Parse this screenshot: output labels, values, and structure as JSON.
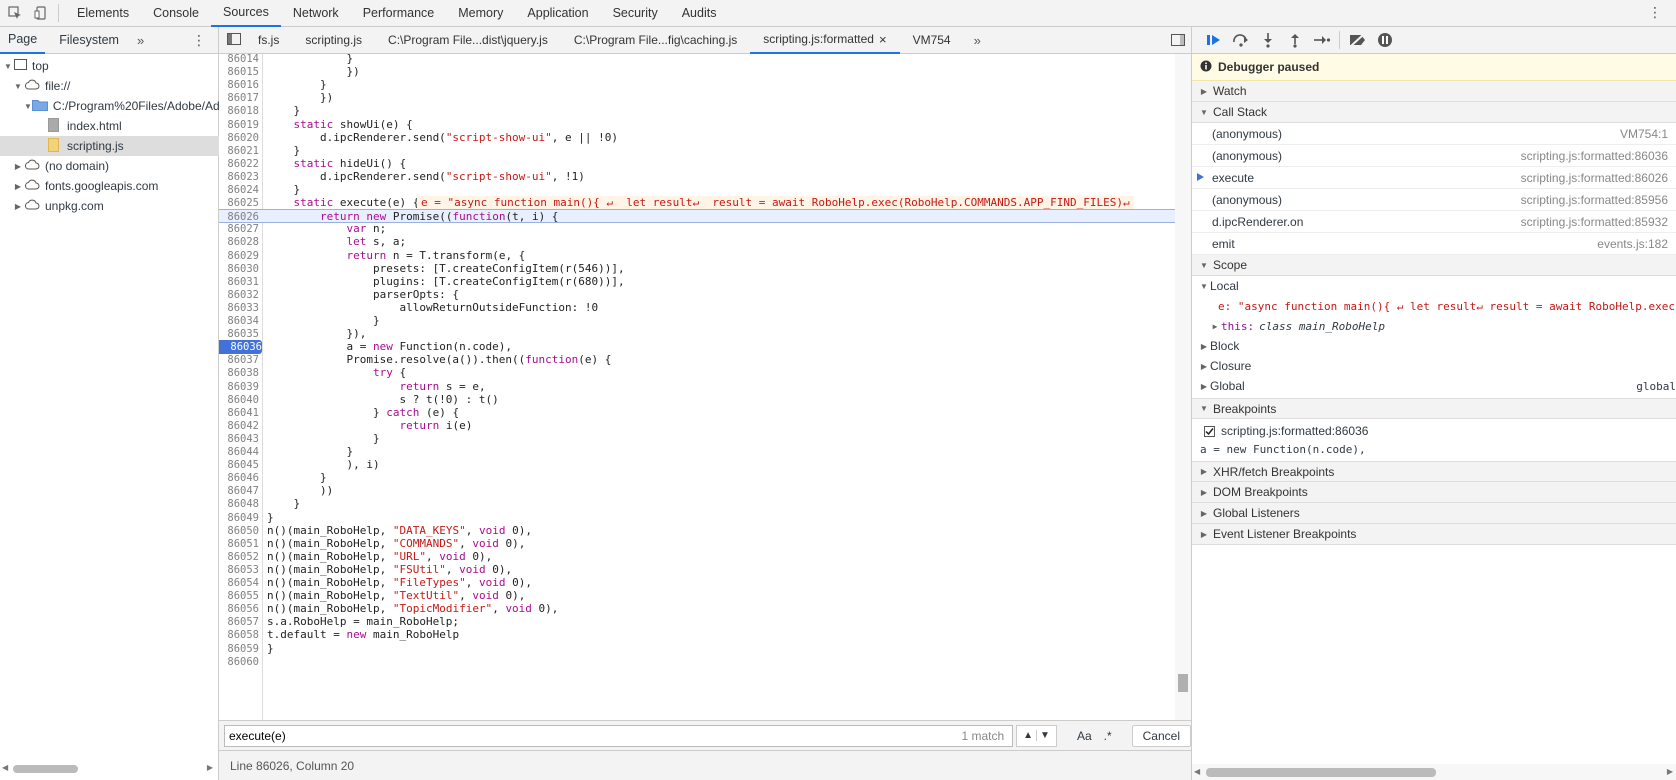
{
  "toolbar": {
    "tabs": [
      "Elements",
      "Console",
      "Sources",
      "Network",
      "Performance",
      "Memory",
      "Application",
      "Security",
      "Audits"
    ],
    "active_tab": "Sources"
  },
  "navigator": {
    "tabs": [
      "Page",
      "Filesystem"
    ],
    "tree": [
      "top",
      "file://",
      "C:/Program%20Files/Adobe/Ad",
      "index.html",
      "scripting.js",
      "(no domain)",
      "fonts.googleapis.com",
      "unpkg.com"
    ]
  },
  "editor": {
    "file_tabs": [
      "fs.js",
      "scripting.js",
      "C:\\Program File...dist\\jquery.js",
      "C:\\Program File...fig\\caching.js",
      "scripting.js:formatted",
      "VM754"
    ],
    "close_icon": "×",
    "lines": [
      {
        "n": "86014",
        "code": "            }"
      },
      {
        "n": "86015",
        "code": "            })"
      },
      {
        "n": "86016",
        "code": "        }"
      },
      {
        "n": "86017",
        "code": "        })"
      },
      {
        "n": "86018",
        "code": "    }"
      },
      {
        "n": "86019",
        "code": "    static showUi(e) {"
      },
      {
        "n": "86020",
        "code": "        d.ipcRenderer.send(\"script-show-ui\", e || !0)"
      },
      {
        "n": "86021",
        "code": "    }"
      },
      {
        "n": "86022",
        "code": "    static hideUi() {"
      },
      {
        "n": "86023",
        "code": "        d.ipcRenderer.send(\"script-show-ui\", !1)"
      },
      {
        "n": "86024",
        "code": "    }"
      },
      {
        "n": "86025",
        "code": "    static execute(e) {"
      },
      {
        "n": "86026",
        "code": "        return new Promise((function(t, i) {"
      },
      {
        "n": "86027",
        "code": "            var n;"
      },
      {
        "n": "86028",
        "code": "            let s, a;"
      },
      {
        "n": "86029",
        "code": "            return n = T.transform(e, {"
      },
      {
        "n": "86030",
        "code": "                presets: [T.createConfigItem(r(546))],"
      },
      {
        "n": "86031",
        "code": "                plugins: [T.createConfigItem(r(680))],"
      },
      {
        "n": "86032",
        "code": "                parserOpts: {"
      },
      {
        "n": "86033",
        "code": "                    allowReturnOutsideFunction: !0"
      },
      {
        "n": "86034",
        "code": "                }"
      },
      {
        "n": "86035",
        "code": "            }),"
      },
      {
        "n": "86036",
        "code": "            a = new Function(n.code),"
      },
      {
        "n": "86037",
        "code": "            Promise.resolve(a()).then((function(e) {"
      },
      {
        "n": "86038",
        "code": "                try {"
      },
      {
        "n": "86039",
        "code": "                    return s = e,"
      },
      {
        "n": "86040",
        "code": "                    s ? t(!0) : t()"
      },
      {
        "n": "86041",
        "code": "                } catch (e) {"
      },
      {
        "n": "86042",
        "code": "                    return i(e)"
      },
      {
        "n": "86043",
        "code": "                }"
      },
      {
        "n": "86044",
        "code": "            }"
      },
      {
        "n": "86045",
        "code": "            ), i)"
      },
      {
        "n": "86046",
        "code": "        }"
      },
      {
        "n": "86047",
        "code": "        ))"
      },
      {
        "n": "86048",
        "code": "    }"
      },
      {
        "n": "86049",
        "code": "}"
      },
      {
        "n": "86050",
        "code": "n()(main_RoboHelp, \"DATA_KEYS\", void 0),"
      },
      {
        "n": "86051",
        "code": "n()(main_RoboHelp, \"COMMANDS\", void 0),"
      },
      {
        "n": "86052",
        "code": "n()(main_RoboHelp, \"URL\", void 0),"
      },
      {
        "n": "86053",
        "code": "n()(main_RoboHelp, \"FSUtil\", void 0),"
      },
      {
        "n": "86054",
        "code": "n()(main_RoboHelp, \"FileTypes\", void 0),"
      },
      {
        "n": "86055",
        "code": "n()(main_RoboHelp, \"TextUtil\", void 0),"
      },
      {
        "n": "86056",
        "code": "n()(main_RoboHelp, \"TopicModifier\", void 0),"
      },
      {
        "n": "86057",
        "code": "s.a.RoboHelp = main_RoboHelp;"
      },
      {
        "n": "86058",
        "code": "t.default = new main_RoboHelp"
      },
      {
        "n": "86059",
        "code": "}"
      },
      {
        "n": "86060",
        "code": ""
      }
    ],
    "inline_value": "e = \"async function main(){ ↵  let result↵  result = await RoboHelp.exec(RoboHelp.COMMANDS.APP_FIND_FILES)↵",
    "current_line": "86026",
    "breakpoint_line": "86036"
  },
  "search": {
    "query": "execute(e)",
    "match_count": "1 match",
    "aa_label": "Aa",
    "regex_label": ".*",
    "cancel_label": "Cancel"
  },
  "status": {
    "position": "Line 86026, Column 20"
  },
  "debugger": {
    "paused_label": "Debugger paused",
    "sections": {
      "watch": "Watch",
      "call_stack": "Call Stack",
      "scope": "Scope",
      "breakpoints": "Breakpoints",
      "xhr": "XHR/fetch Breakpoints",
      "dom": "DOM Breakpoints",
      "global_listeners": "Global Listeners",
      "event_listeners": "Event Listener Breakpoints"
    },
    "call_stack": [
      {
        "fn": "(anonymous)",
        "loc": "VM754:1"
      },
      {
        "fn": "(anonymous)",
        "loc": "scripting.js:formatted:86036"
      },
      {
        "fn": "execute",
        "loc": "scripting.js:formatted:86026"
      },
      {
        "fn": "(anonymous)",
        "loc": "scripting.js:formatted:85956"
      },
      {
        "fn": "d.ipcRenderer.on",
        "loc": "scripting.js:formatted:85932"
      },
      {
        "fn": "emit",
        "loc": "events.js:182"
      }
    ],
    "scope": {
      "local_label": "Local",
      "e_value": "e: \"async function main(){ ↵  let result↵  result = await RoboHelp.exec",
      "this_label": "this:",
      "this_value": "class main_RoboHelp",
      "block_label": "Block",
      "closure_label": "Closure",
      "global_label": "Global",
      "global_value": "global"
    },
    "breakpoint": {
      "location": "scripting.js:formatted:86036",
      "snippet": "a = new Function(n.code),"
    }
  }
}
